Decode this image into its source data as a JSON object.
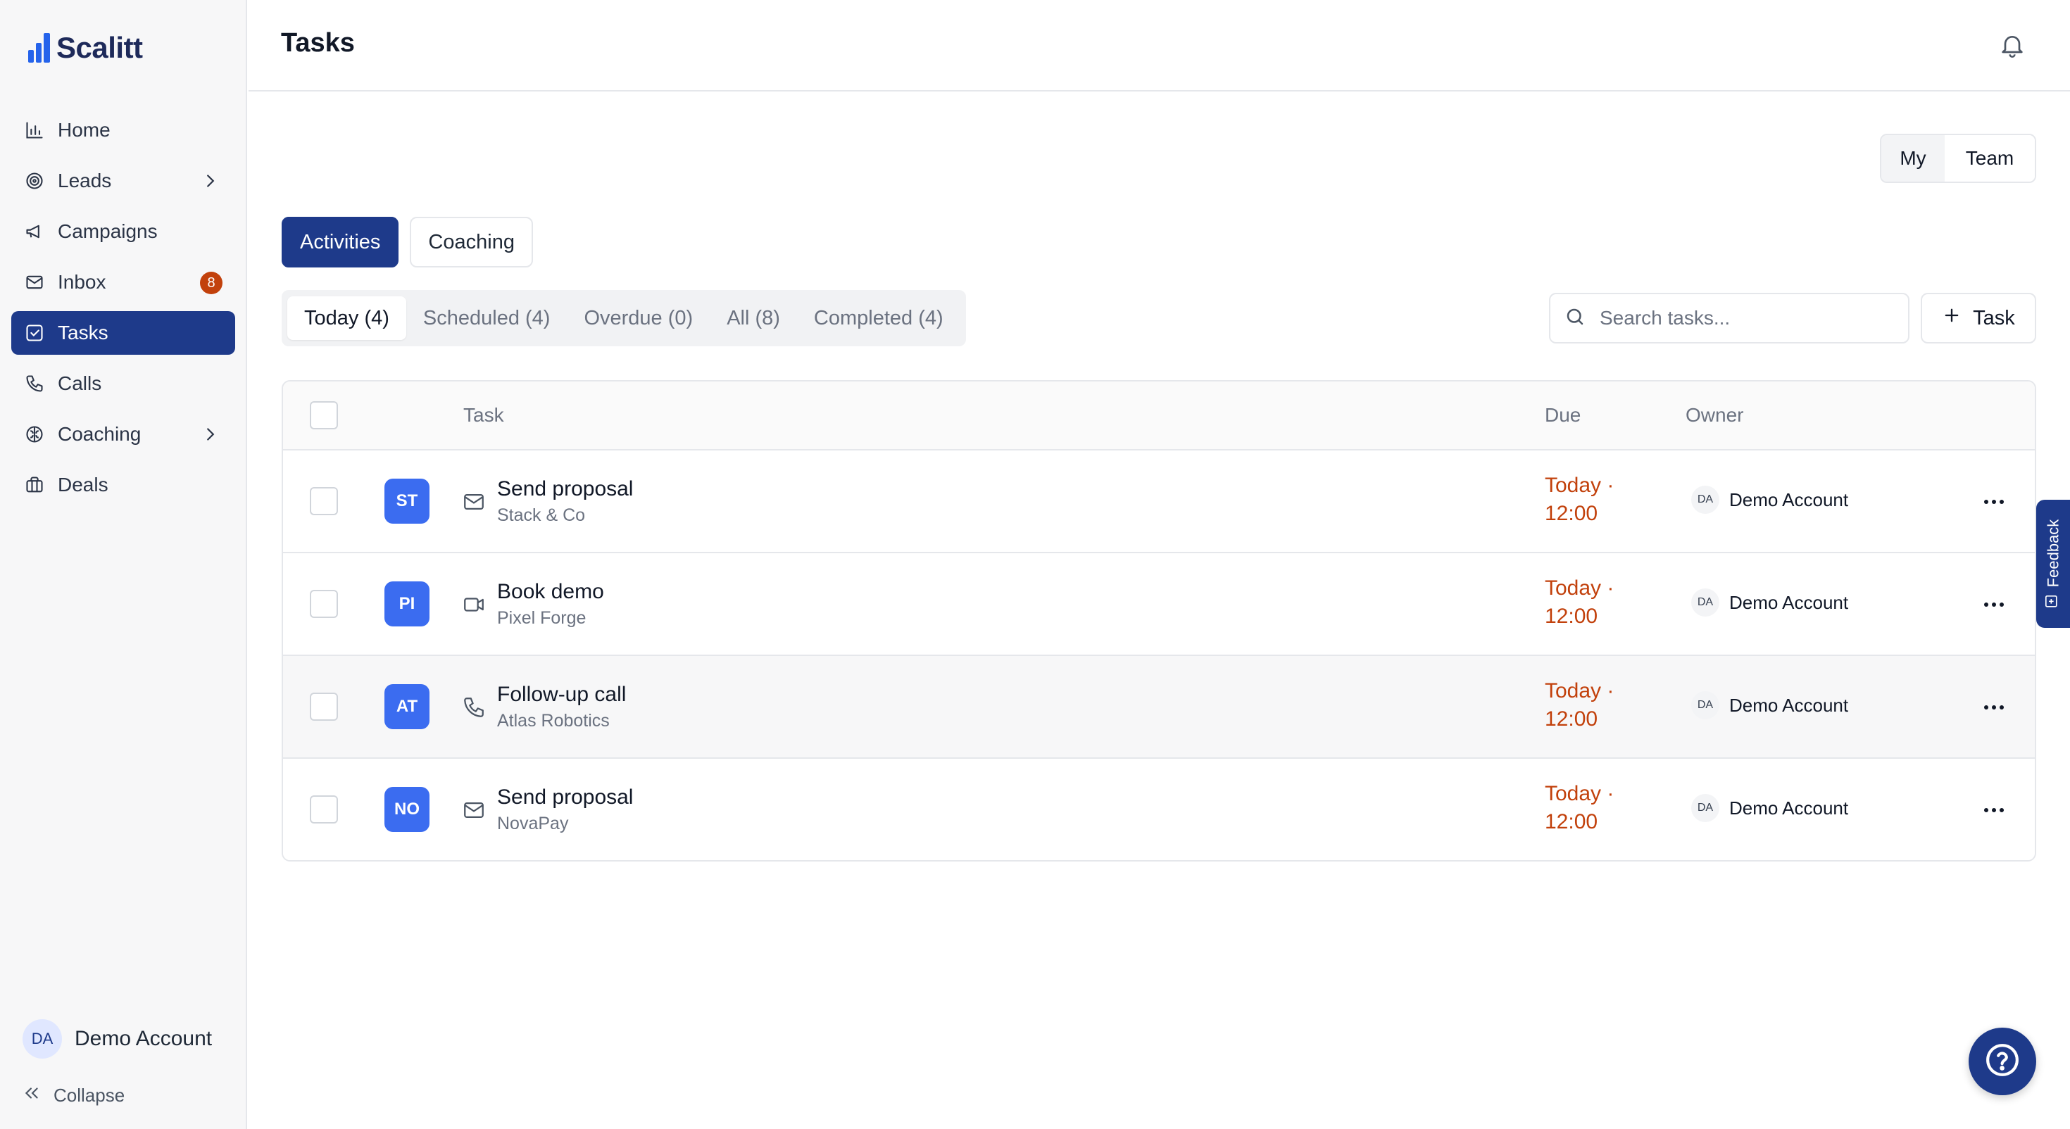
{
  "app": {
    "brand": "Scalitt"
  },
  "sidebar": {
    "items": [
      {
        "label": "Home",
        "icon": "chart-bars-icon"
      },
      {
        "label": "Leads",
        "icon": "target-icon"
      },
      {
        "label": "Campaigns",
        "icon": "megaphone-icon"
      },
      {
        "label": "Inbox",
        "icon": "mail-icon",
        "badge": "8"
      },
      {
        "label": "Tasks",
        "icon": "checkbox-icon",
        "active": true
      },
      {
        "label": "Calls",
        "icon": "phone-icon"
      },
      {
        "label": "Coaching",
        "icon": "brain-icon"
      },
      {
        "label": "Deals",
        "icon": "briefcase-icon"
      }
    ],
    "user": {
      "initials": "DA",
      "name": "Demo Account"
    },
    "collapse_label": "Collapse"
  },
  "header": {
    "title": "Tasks"
  },
  "scope": {
    "my": "My",
    "team": "Team",
    "selected": "My"
  },
  "main_tabs": [
    {
      "label": "Activities",
      "active": true
    },
    {
      "label": "Coaching",
      "active": false
    }
  ],
  "filters": [
    {
      "label": "Today (4)",
      "active": true
    },
    {
      "label": "Scheduled (4)"
    },
    {
      "label": "Overdue (0)"
    },
    {
      "label": "All (8)"
    },
    {
      "label": "Completed (4)"
    }
  ],
  "search": {
    "placeholder": "Search tasks..."
  },
  "add_task_label": "Task",
  "table": {
    "columns": {
      "task": "Task",
      "due": "Due",
      "owner": "Owner"
    },
    "rows": [
      {
        "initials": "ST",
        "type_icon": "mail-icon",
        "title": "Send proposal",
        "company": "Stack & Co",
        "due_day": "Today ·",
        "due_time": "12:00",
        "owner_initials": "DA",
        "owner": "Demo Account"
      },
      {
        "initials": "PI",
        "type_icon": "video-icon",
        "title": "Book demo",
        "company": "Pixel Forge",
        "due_day": "Today ·",
        "due_time": "12:00",
        "owner_initials": "DA",
        "owner": "Demo Account"
      },
      {
        "initials": "AT",
        "type_icon": "phone-icon",
        "title": "Follow-up call",
        "company": "Atlas Robotics",
        "due_day": "Today ·",
        "due_time": "12:00",
        "owner_initials": "DA",
        "owner": "Demo Account"
      },
      {
        "initials": "NO",
        "type_icon": "mail-icon",
        "title": "Send proposal",
        "company": "NovaPay",
        "due_day": "Today ·",
        "due_time": "12:00",
        "owner_initials": "DA",
        "owner": "Demo Account"
      }
    ]
  },
  "feedback_label": "Feedback",
  "colors": {
    "primary": "#1e3a8a",
    "accent": "#3b6cf0",
    "due": "#c2410c",
    "badge": "#c2410c"
  }
}
